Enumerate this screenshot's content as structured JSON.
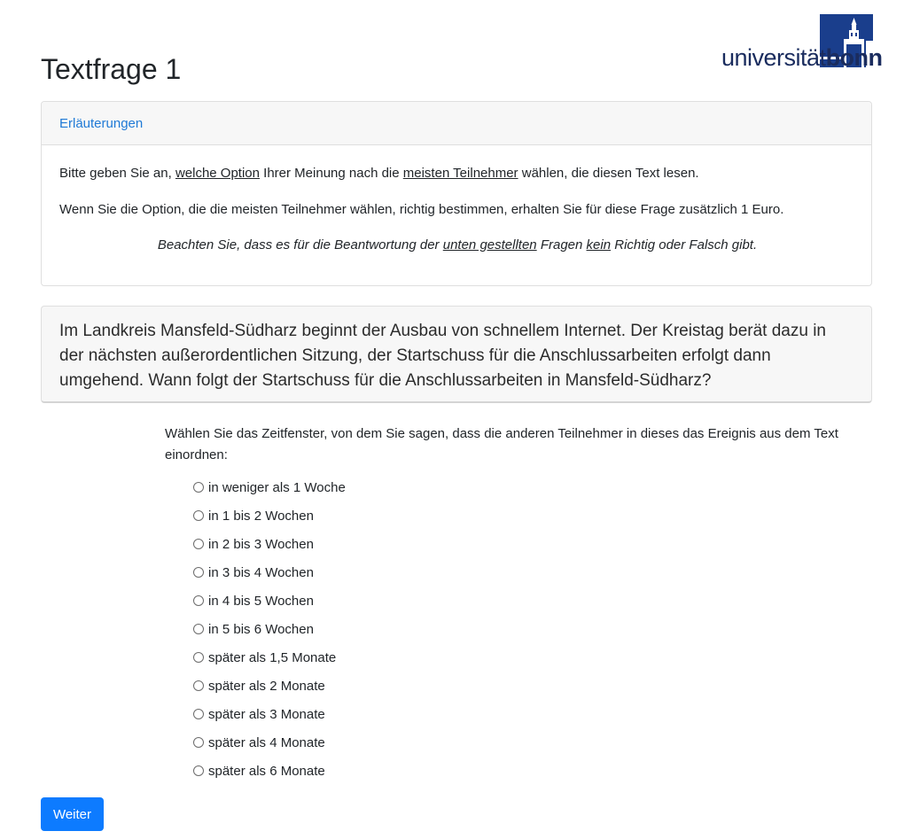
{
  "page": {
    "title": "Textfrage 1"
  },
  "logo": {
    "text_regular": "universität",
    "text_bold": "bonn",
    "color": "#1a3e8c"
  },
  "explanation": {
    "header_link": "Erläuterungen",
    "p1": {
      "a": "Bitte geben Sie an, ",
      "b": "welche Option",
      "c": " Ihrer Meinung nach die ",
      "d": "meisten Teilnehmer",
      "e": " wählen, die diesen Text lesen."
    },
    "p2": "Wenn Sie die Option, die die meisten Teilnehmer wählen, richtig bestimmen, erhalten Sie für diese Frage zusätzlich 1 Euro.",
    "p3": {
      "a": "Beachten Sie, dass es für die Beantwortung der ",
      "b": "unten gestellten",
      "c": " Fragen ",
      "d": "kein",
      "e": " Richtig oder Falsch gibt."
    }
  },
  "question": {
    "text": "Im Landkreis Mansfeld-Südharz beginnt der Ausbau von schnellem Internet. Der Kreistag berät dazu in der nächsten außerordentlichen Sitzung, der Startschuss für die Anschlussarbeiten erfolgt dann umgehend. Wann folgt der Startschuss für die Anschlussarbeiten in Mansfeld-Südharz?"
  },
  "instruction": "Wählen Sie das Zeitfenster, von dem Sie sagen, dass die anderen Teilnehmer in dieses das Ereignis aus dem Text einordnen:",
  "options": [
    {
      "label": "in weniger als 1 Woche",
      "selected": false
    },
    {
      "label": "in 1 bis 2 Wochen",
      "selected": false
    },
    {
      "label": "in 2 bis 3 Wochen",
      "selected": false
    },
    {
      "label": "in 3 bis 4 Wochen",
      "selected": false
    },
    {
      "label": "in 4 bis 5 Wochen",
      "selected": false
    },
    {
      "label": "in 5 bis 6 Wochen",
      "selected": false
    },
    {
      "label": "später als 1,5 Monate",
      "selected": false
    },
    {
      "label": "später als 2 Monate",
      "selected": false
    },
    {
      "label": "später als 3 Monate",
      "selected": false
    },
    {
      "label": "später als 4 Monate",
      "selected": false
    },
    {
      "label": "später als 6 Monate",
      "selected": false
    }
  ],
  "submit": {
    "label": "Weiter",
    "color": "#0d7bff"
  }
}
